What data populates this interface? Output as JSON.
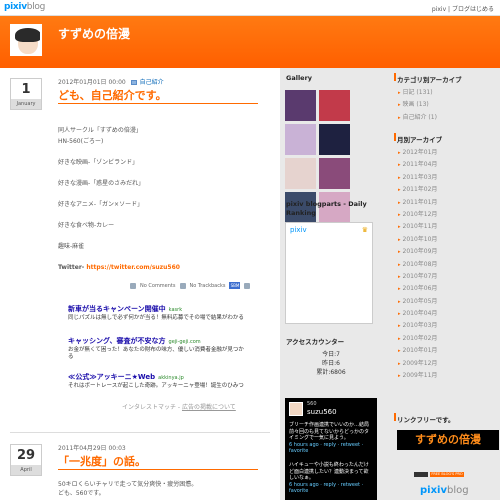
{
  "topbar": {
    "logo_pixiv": "pixiv",
    "logo_blog": "blog",
    "links": "pixiv | ブログはじめる"
  },
  "header": {
    "title": "すずめの倍漫"
  },
  "post1": {
    "day": "1",
    "month": "January",
    "meta_date": "2012年01月01日 00:00",
    "meta_category": "自己紹介",
    "title": "ども、自己紹介です。",
    "lines": [
      "同人サークル「すずめの倍漫」",
      "HN-560(ごろー)",
      "好きな映画-「ゾンビランド」",
      "好きな漫画-「惑星のさみだれ」",
      "好きなアニメ-「ガン×ソード」",
      "好きな食べ物-カレー",
      "趣味-麻雀"
    ],
    "twitter_label": "Twitter- ",
    "twitter_url": "https://twitter.com/suzu560",
    "comments": "No Comments",
    "trackbacks": "No Trackbacks",
    "share_label": "SBM"
  },
  "ads": [
    {
      "title": "新車が当るキャンペーン開催中",
      "host": "kasrk",
      "desc": "同じパズルは無しで必ず何かが当る！無料応募でその場で結果がわかる"
    },
    {
      "title": "キャッシング、審査が不安な方",
      "host": "geji-geji.com",
      "desc": "お金が無くて困った！あなたの財布の味方、優しい消費者金融が見つかる"
    },
    {
      "title": "≪公式≫アッキーニ★Web",
      "host": "akkinya.jp",
      "desc": "それはボートレースが起こした奇跡。アッキーニャ登場！誕生のひみつ"
    }
  ],
  "ad_footer": {
    "text": "インタレストマッチ - ",
    "link": "広告の掲載について"
  },
  "post2": {
    "day": "29",
    "month": "April",
    "meta_date": "2011年04月29日 00:03",
    "title": "「一兆度」の話。",
    "lines": [
      "50キロくらいチャリで走って気分爽快・疲労困憊。",
      "ども、560です。"
    ]
  },
  "mid": {
    "gallery_title": "Gallery",
    "gallery_colors": [
      "#5a3a6e",
      "#c23a4a",
      "#c9b2d6",
      "#1e2140",
      "#e6d3cf",
      "#8a4b7a",
      "#3b4b6a",
      "#d6a8c4"
    ],
    "ranking_title": "pixiv blogparts - Daily Ranking",
    "ranking_logo": "pixiv",
    "counter_title": "アクセスカウンター",
    "counter_lines": [
      "今日:7",
      "昨日:6",
      "累計:6806"
    ],
    "twitter_widget": {
      "num": "560",
      "name": "suzu560",
      "tweets": [
        {
          "text": "ブリーチ作画連携でいいのか…結局前々回のも見てないからどっかのタイミングで一気に見よう。",
          "time": "6 hours ago · reply · retweet · favorite"
        },
        {
          "text": "ハイキューや小説も終わったんだけど面白連携したい？連動決まって欲しいなぁ。",
          "time": "6 hours ago · reply · retweet · favorite"
        }
      ]
    }
  },
  "right": {
    "category_title": "カテゴリ別アーカイブ",
    "categories": [
      "日記 (131)",
      "映画 (13)",
      "自己紹介 (1)"
    ],
    "monthly_title": "月別アーカイブ",
    "months": [
      "2012年01月",
      "2011年04月",
      "2011年03月",
      "2011年02月",
      "2011年01月",
      "2010年12月",
      "2010年11月",
      "2010年10月",
      "2010年09月",
      "2010年08月",
      "2010年07月",
      "2010年06月",
      "2010年05月",
      "2010年04月",
      "2010年03月",
      "2010年02月",
      "2010年01月",
      "2009年12月",
      "2009年11月"
    ],
    "link_title": "リンクフリーです。",
    "link_banner": "すずめの倍漫",
    "badge_text": "FREE BLOG'S PRO",
    "footer_pixiv": "pixiv",
    "footer_blog": "blog"
  }
}
